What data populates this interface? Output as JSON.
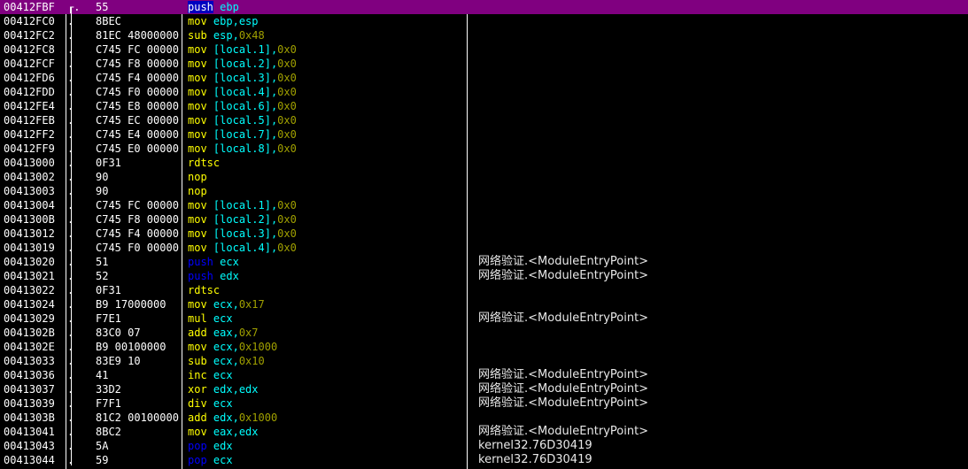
{
  "disassembly": {
    "rows": [
      {
        "addr": "00412FBF",
        "mark": "┌.",
        "hex": "55",
        "op": "push",
        "args": [
          {
            "t": "r",
            "v": "ebp"
          }
        ],
        "comment": ""
      },
      {
        "addr": "00412FC0",
        "mark": ".",
        "hex": "8BEC",
        "op": "mov",
        "args": [
          {
            "t": "r",
            "v": "ebp,esp"
          }
        ],
        "comment": ""
      },
      {
        "addr": "00412FC2",
        "mark": ".",
        "hex": "81EC 48000000",
        "op": "sub",
        "args": [
          {
            "t": "r",
            "v": "esp,"
          },
          {
            "t": "i",
            "v": "0x48"
          }
        ],
        "comment": ""
      },
      {
        "addr": "00412FC8",
        "mark": ".",
        "hex": "C745 FC 00000",
        "op": "mov",
        "args": [
          {
            "t": "r",
            "v": "[local.1],"
          },
          {
            "t": "i",
            "v": "0x0"
          }
        ],
        "comment": ""
      },
      {
        "addr": "00412FCF",
        "mark": ".",
        "hex": "C745 F8 00000",
        "op": "mov",
        "args": [
          {
            "t": "r",
            "v": "[local.2],"
          },
          {
            "t": "i",
            "v": "0x0"
          }
        ],
        "comment": ""
      },
      {
        "addr": "00412FD6",
        "mark": ".",
        "hex": "C745 F4 00000",
        "op": "mov",
        "args": [
          {
            "t": "r",
            "v": "[local.3],"
          },
          {
            "t": "i",
            "v": "0x0"
          }
        ],
        "comment": ""
      },
      {
        "addr": "00412FDD",
        "mark": ".",
        "hex": "C745 F0 00000",
        "op": "mov",
        "args": [
          {
            "t": "r",
            "v": "[local.4],"
          },
          {
            "t": "i",
            "v": "0x0"
          }
        ],
        "comment": ""
      },
      {
        "addr": "00412FE4",
        "mark": ".",
        "hex": "C745 E8 00000",
        "op": "mov",
        "args": [
          {
            "t": "r",
            "v": "[local.6],"
          },
          {
            "t": "i",
            "v": "0x0"
          }
        ],
        "comment": ""
      },
      {
        "addr": "00412FEB",
        "mark": ".",
        "hex": "C745 EC 00000",
        "op": "mov",
        "args": [
          {
            "t": "r",
            "v": "[local.5],"
          },
          {
            "t": "i",
            "v": "0x0"
          }
        ],
        "comment": ""
      },
      {
        "addr": "00412FF2",
        "mark": ".",
        "hex": "C745 E4 00000",
        "op": "mov",
        "args": [
          {
            "t": "r",
            "v": "[local.7],"
          },
          {
            "t": "i",
            "v": "0x0"
          }
        ],
        "comment": ""
      },
      {
        "addr": "00412FF9",
        "mark": ".",
        "hex": "C745 E0 00000",
        "op": "mov",
        "args": [
          {
            "t": "r",
            "v": "[local.8],"
          },
          {
            "t": "i",
            "v": "0x0"
          }
        ],
        "comment": ""
      },
      {
        "addr": "00413000",
        "mark": ".",
        "hex": "0F31",
        "op": "rdtsc",
        "args": [],
        "comment": ""
      },
      {
        "addr": "00413002",
        "mark": ".",
        "hex": "90",
        "op": "nop",
        "args": [],
        "comment": ""
      },
      {
        "addr": "00413003",
        "mark": ".",
        "hex": "90",
        "op": "nop",
        "args": [],
        "comment": ""
      },
      {
        "addr": "00413004",
        "mark": ".",
        "hex": "C745 FC 00000",
        "op": "mov",
        "args": [
          {
            "t": "r",
            "v": "[local.1],"
          },
          {
            "t": "i",
            "v": "0x0"
          }
        ],
        "comment": ""
      },
      {
        "addr": "0041300B",
        "mark": ".",
        "hex": "C745 F8 00000",
        "op": "mov",
        "args": [
          {
            "t": "r",
            "v": "[local.2],"
          },
          {
            "t": "i",
            "v": "0x0"
          }
        ],
        "comment": ""
      },
      {
        "addr": "00413012",
        "mark": ".",
        "hex": "C745 F4 00000",
        "op": "mov",
        "args": [
          {
            "t": "r",
            "v": "[local.3],"
          },
          {
            "t": "i",
            "v": "0x0"
          }
        ],
        "comment": ""
      },
      {
        "addr": "00413019",
        "mark": ".",
        "hex": "C745 F0 00000",
        "op": "mov",
        "args": [
          {
            "t": "r",
            "v": "[local.4],"
          },
          {
            "t": "i",
            "v": "0x0"
          }
        ],
        "comment": ""
      },
      {
        "addr": "00413020",
        "mark": ".",
        "hex": "51",
        "op": "push",
        "args": [
          {
            "t": "r",
            "v": "ecx"
          }
        ],
        "comment": "网络验证.<ModuleEntryPoint>"
      },
      {
        "addr": "00413021",
        "mark": ".",
        "hex": "52",
        "op": "push",
        "args": [
          {
            "t": "r",
            "v": "edx"
          }
        ],
        "comment": "网络验证.<ModuleEntryPoint>"
      },
      {
        "addr": "00413022",
        "mark": ".",
        "hex": "0F31",
        "op": "rdtsc",
        "args": [],
        "comment": ""
      },
      {
        "addr": "00413024",
        "mark": ".",
        "hex": "B9 17000000",
        "op": "mov",
        "args": [
          {
            "t": "r",
            "v": "ecx,"
          },
          {
            "t": "i",
            "v": "0x17"
          }
        ],
        "comment": ""
      },
      {
        "addr": "00413029",
        "mark": ".",
        "hex": "F7E1",
        "op": "mul",
        "args": [
          {
            "t": "r",
            "v": "ecx"
          }
        ],
        "comment": "网络验证.<ModuleEntryPoint>"
      },
      {
        "addr": "0041302B",
        "mark": ".",
        "hex": "83C0 07",
        "op": "add",
        "args": [
          {
            "t": "r",
            "v": "eax,"
          },
          {
            "t": "i",
            "v": "0x7"
          }
        ],
        "comment": ""
      },
      {
        "addr": "0041302E",
        "mark": ".",
        "hex": "B9 00100000",
        "op": "mov",
        "args": [
          {
            "t": "r",
            "v": "ecx,"
          },
          {
            "t": "i",
            "v": "0x1000"
          }
        ],
        "comment": ""
      },
      {
        "addr": "00413033",
        "mark": ".",
        "hex": "83E9 10",
        "op": "sub",
        "args": [
          {
            "t": "r",
            "v": "ecx,"
          },
          {
            "t": "i",
            "v": "0x10"
          }
        ],
        "comment": ""
      },
      {
        "addr": "00413036",
        "mark": ".",
        "hex": "41",
        "op": "inc",
        "args": [
          {
            "t": "r",
            "v": "ecx"
          }
        ],
        "comment": "网络验证.<ModuleEntryPoint>"
      },
      {
        "addr": "00413037",
        "mark": ".",
        "hex": "33D2",
        "op": "xor",
        "args": [
          {
            "t": "r",
            "v": "edx,edx"
          }
        ],
        "comment": "网络验证.<ModuleEntryPoint>"
      },
      {
        "addr": "00413039",
        "mark": ".",
        "hex": "F7F1",
        "op": "div",
        "args": [
          {
            "t": "r",
            "v": "ecx"
          }
        ],
        "comment": "网络验证.<ModuleEntryPoint>"
      },
      {
        "addr": "0041303B",
        "mark": ".",
        "hex": "81C2 00100000",
        "op": "add",
        "args": [
          {
            "t": "r",
            "v": "edx,"
          },
          {
            "t": "i",
            "v": "0x1000"
          }
        ],
        "comment": ""
      },
      {
        "addr": "00413041",
        "mark": ".",
        "hex": "8BC2",
        "op": "mov",
        "args": [
          {
            "t": "r",
            "v": "eax,edx"
          }
        ],
        "comment": "网络验证.<ModuleEntryPoint>"
      },
      {
        "addr": "00413043",
        "mark": ".",
        "hex": "5A",
        "op": "pop",
        "args": [
          {
            "t": "r",
            "v": "edx"
          }
        ],
        "comment": "kernel32.76D30419"
      },
      {
        "addr": "00413044",
        "mark": ".",
        "hex": "59",
        "op": "pop",
        "args": [
          {
            "t": "r",
            "v": "ecx"
          }
        ],
        "comment": "kernel32.76D30419"
      }
    ]
  },
  "colors": {
    "background": "#000000",
    "selected_row": "#800080",
    "opcode_default": "#ffff00",
    "opcode_stack": "#0000ff",
    "register_operand": "#00ffff",
    "immediate": "#a0a000",
    "text": "#ffffff"
  }
}
